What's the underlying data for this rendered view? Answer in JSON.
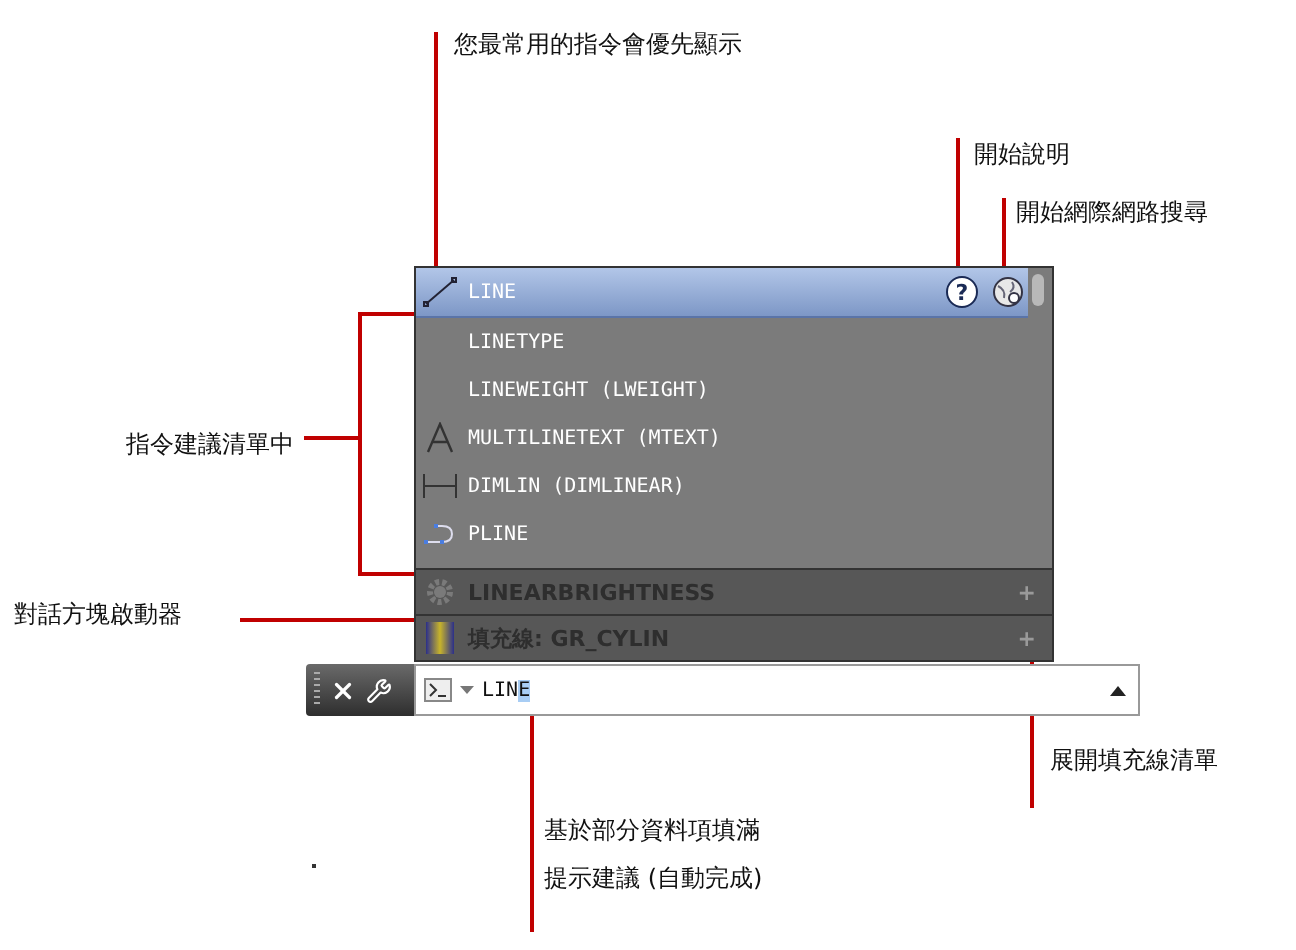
{
  "annotations": [
    {
      "text": "您最常用的指令會優先顯示"
    },
    {
      "text": "開始說明"
    },
    {
      "text": "開始網際網路搜尋"
    },
    {
      "text": "指令建議清單中"
    },
    {
      "text": "對話方塊啟動器"
    },
    {
      "text": "展開填充線清單"
    },
    {
      "text": "基於部分資料項填滿"
    },
    {
      "text": "提示建議 (自動完成)"
    }
  ],
  "suggestions": [
    {
      "label": "LINE",
      "kind": "line",
      "selected": true
    },
    {
      "label": "LINETYPE",
      "kind": "plain",
      "selected": false
    },
    {
      "label": "LINEWEIGHT (LWEIGHT)",
      "kind": "plain",
      "selected": false
    },
    {
      "label": "MULTILINETEXT (MTEXT)",
      "kind": "text",
      "selected": false
    },
    {
      "label": "DIMLIN (DIMLINEAR)",
      "kind": "dimension",
      "selected": false
    },
    {
      "label": "PLINE",
      "kind": "polyline",
      "selected": false
    }
  ],
  "help_button": {
    "label": "?"
  },
  "sections": [
    {
      "label": "LINEARBRIGHTNESS",
      "kind": "setting",
      "expand": "+"
    },
    {
      "label": "填充線: GR_CYLIN",
      "kind": "hatch",
      "expand": "+"
    }
  ],
  "command_line": {
    "typed": "LIN",
    "completion": "E"
  }
}
